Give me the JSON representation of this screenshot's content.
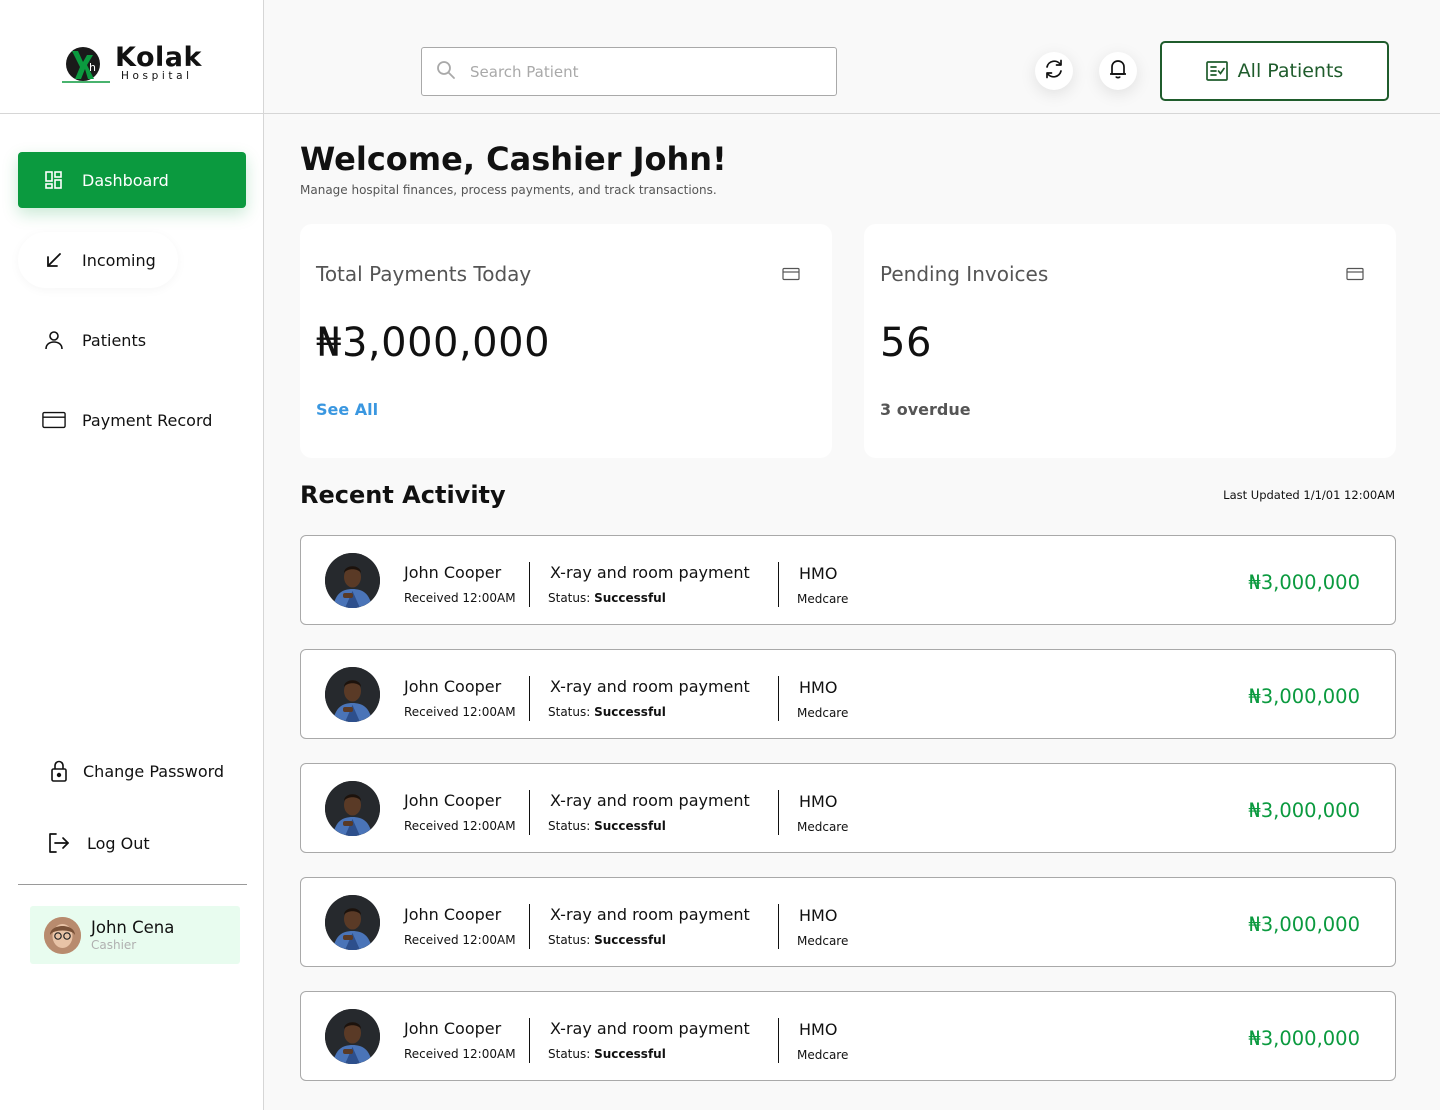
{
  "brand": {
    "name": "Kolak",
    "sub": "Hospital",
    "accent": "#0b9a3f"
  },
  "sidebar": {
    "items": [
      {
        "label": "Dashboard",
        "icon": "dashboard-icon",
        "active": true
      },
      {
        "label": "Incoming",
        "icon": "arrow-down-left-icon"
      },
      {
        "label": "Patients",
        "icon": "user-icon"
      },
      {
        "label": "Payment Record",
        "icon": "card-icon"
      }
    ],
    "change_password": "Change Password",
    "logout": "Log Out",
    "user": {
      "name": "John Cena",
      "role": "Cashier"
    }
  },
  "header": {
    "search_placeholder": "Search Patient",
    "all_patients": "All Patients"
  },
  "main": {
    "welcome": "Welcome, Cashier John!",
    "subtitle": "Manage hospital finances, process payments, and track transactions.",
    "cards": [
      {
        "title": "Total Payments Today",
        "value": "₦3,000,000",
        "link": "See All"
      },
      {
        "title": "Pending Invoices",
        "value": "56",
        "note": "3 overdue"
      }
    ],
    "recent_title": "Recent Activity",
    "last_updated": "Last Updated 1/1/01 12:00AM",
    "activities": [
      {
        "name": "John Cooper",
        "received": "Received 12:00AM",
        "desc": "X-ray and room payment",
        "status_label": "Status:",
        "status": "Successful",
        "type": "HMO",
        "provider": "Medcare",
        "amount": "₦3,000,000"
      },
      {
        "name": "John Cooper",
        "received": "Received 12:00AM",
        "desc": "X-ray and room payment",
        "status_label": "Status:",
        "status": "Successful",
        "type": "HMO",
        "provider": "Medcare",
        "amount": "₦3,000,000"
      },
      {
        "name": "John Cooper",
        "received": "Received 12:00AM",
        "desc": "X-ray and room payment",
        "status_label": "Status:",
        "status": "Successful",
        "type": "HMO",
        "provider": "Medcare",
        "amount": "₦3,000,000"
      },
      {
        "name": "John Cooper",
        "received": "Received 12:00AM",
        "desc": "X-ray and room payment",
        "status_label": "Status:",
        "status": "Successful",
        "type": "HMO",
        "provider": "Medcare",
        "amount": "₦3,000,000"
      },
      {
        "name": "John Cooper",
        "received": "Received 12:00AM",
        "desc": "X-ray and room payment",
        "status_label": "Status:",
        "status": "Successful",
        "type": "HMO",
        "provider": "Medcare",
        "amount": "₦3,000,000"
      }
    ]
  }
}
